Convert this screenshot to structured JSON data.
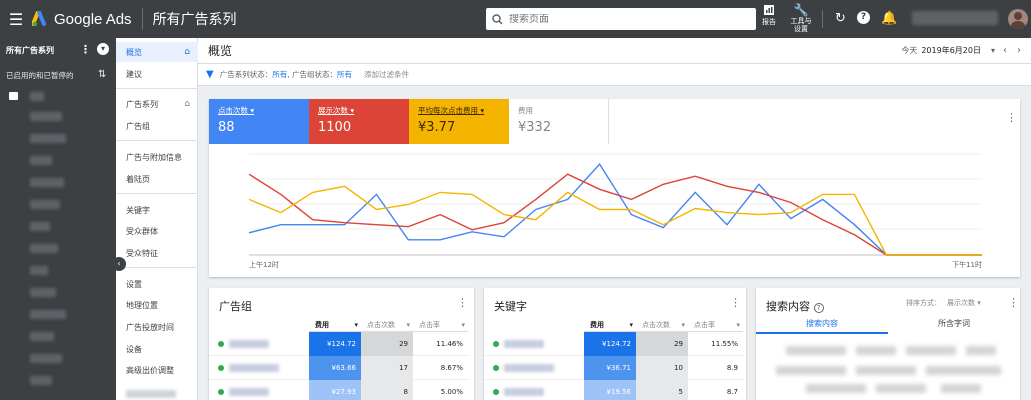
{
  "app": {
    "logo_text": "Google Ads",
    "page_title": "所有广告系列"
  },
  "search": {
    "placeholder": "搜索页面"
  },
  "toolbar": {
    "reports_label": "报告",
    "tools_label": "工具与设置"
  },
  "colors": {
    "blue": "#4285f4",
    "red": "#db4437",
    "orange": "#f4b400",
    "topbar": "#3c4043"
  },
  "account_panel": {
    "title": "所有广告系列",
    "subtitle": "已启用的和已暂停的"
  },
  "nav": {
    "items": [
      {
        "label": "概览"
      },
      {
        "label": "建议"
      },
      {
        "label": "广告系列"
      },
      {
        "label": "广告组"
      },
      {
        "label": "广告与附加信息"
      },
      {
        "label": "着陆页"
      },
      {
        "label": "关键字"
      },
      {
        "label": "受众群体"
      },
      {
        "label": "受众特征"
      },
      {
        "label": "设置"
      },
      {
        "label": "地理位置"
      },
      {
        "label": "广告投放时间"
      },
      {
        "label": "设备"
      },
      {
        "label": "高级出价调整"
      }
    ]
  },
  "overview": {
    "title": "概览",
    "date_prefix": "今天",
    "date_value": "2019年6月20日"
  },
  "filter": {
    "text_a": "广告系列状态：",
    "val_a": "所有",
    "text_b": "广告组状态：",
    "val_b": "所有",
    "add": "添加过滤条件"
  },
  "metrics": [
    {
      "label": "点击次数",
      "value": "88"
    },
    {
      "label": "展示次数",
      "value": "1100"
    },
    {
      "label": "平均每次点击费用",
      "value": "¥3.77"
    },
    {
      "label": "费用",
      "value": "¥332"
    }
  ],
  "chart_data": {
    "type": "line",
    "x_start_label": "上午12时",
    "x_end_label": "下午11时",
    "x": [
      0,
      1,
      2,
      3,
      4,
      5,
      6,
      7,
      8,
      9,
      10,
      11,
      12,
      13,
      14,
      15,
      16,
      17,
      18,
      19,
      20,
      21,
      22,
      23
    ],
    "series": [
      {
        "name": "点击次数",
        "color": "#4285f4",
        "values": [
          0.22,
          0.3,
          0.3,
          0.3,
          0.6,
          0.15,
          0.15,
          0.23,
          0.18,
          0.45,
          0.55,
          0.9,
          0.4,
          0.27,
          0.62,
          0.3,
          0.7,
          0.36,
          0.55,
          0.3,
          0.0,
          0.0,
          0.0,
          0.0
        ]
      },
      {
        "name": "展示次数",
        "color": "#db4437",
        "values": [
          0.8,
          0.6,
          0.35,
          0.32,
          0.3,
          0.28,
          0.4,
          0.25,
          0.32,
          0.55,
          0.8,
          0.65,
          0.55,
          0.7,
          0.78,
          0.68,
          0.62,
          0.52,
          0.35,
          0.2,
          0.0,
          0.0,
          0.0,
          0.0
        ]
      },
      {
        "name": "平均每次点击费用",
        "color": "#f4b400",
        "values": [
          0.55,
          0.42,
          0.62,
          0.68,
          0.45,
          0.5,
          0.62,
          0.6,
          0.4,
          0.35,
          0.62,
          0.45,
          0.45,
          0.3,
          0.46,
          0.42,
          0.4,
          0.42,
          0.6,
          0.6,
          0.0,
          0.0,
          0.0,
          0.0
        ]
      }
    ],
    "ylim": [
      0,
      1
    ]
  },
  "adgroups": {
    "title": "广告组",
    "headers": [
      "费用",
      "点击次数",
      "点击率"
    ],
    "rows": [
      {
        "cost": "¥124.72",
        "clicks": "29",
        "ctr": "11.46%"
      },
      {
        "cost": "¥63.66",
        "clicks": "17",
        "ctr": "8.67%"
      },
      {
        "cost": "¥27.93",
        "clicks": "8",
        "ctr": "5.00%"
      }
    ]
  },
  "keywords": {
    "title": "关键字",
    "headers": [
      "费用",
      "点击次数",
      "点击率"
    ],
    "rows": [
      {
        "cost": "¥124.72",
        "clicks": "29",
        "ctr": "11.55%"
      },
      {
        "cost": "¥36.71",
        "clicks": "10",
        "ctr": "8.9"
      },
      {
        "cost": "¥19.56",
        "clicks": "5",
        "ctr": "8.7"
      }
    ]
  },
  "search_terms": {
    "title": "搜索内容",
    "sort_label": "排序方式：",
    "sort_value": "展示次数",
    "tab_active": "搜索内容",
    "tab_other": "所含字词"
  }
}
